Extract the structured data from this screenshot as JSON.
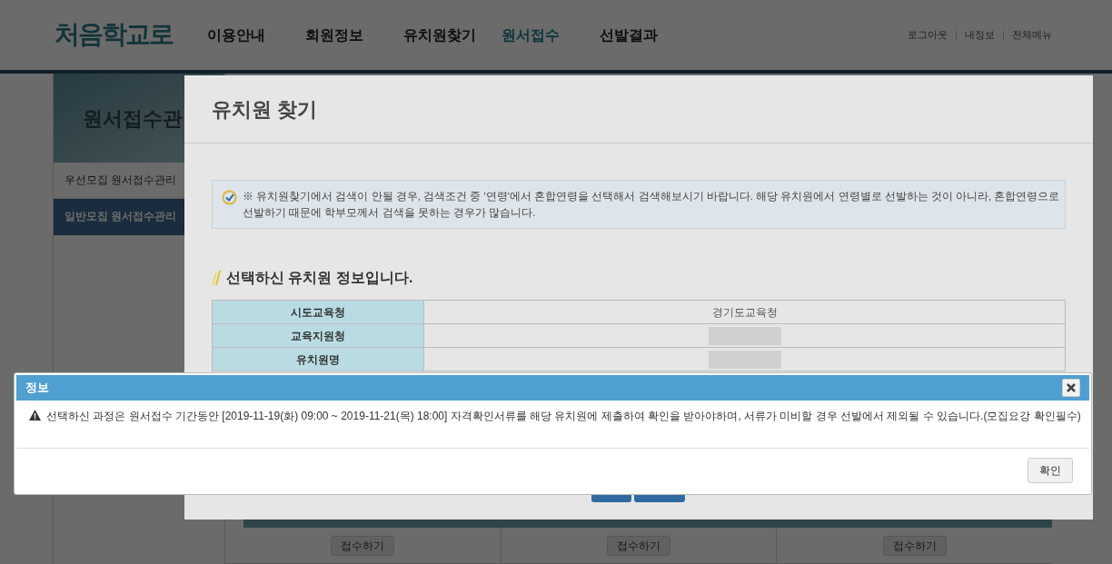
{
  "header": {
    "logo": "처음학교로",
    "nav": [
      {
        "label": "이용안내",
        "selected": false
      },
      {
        "label": "회원정보",
        "selected": false
      },
      {
        "label": "유치원찾기",
        "selected": false
      },
      {
        "label": "원서접수",
        "selected": true
      },
      {
        "label": "선발결과",
        "selected": false
      }
    ],
    "util_links": [
      "로그아웃",
      "내정보",
      "전체메뉴"
    ]
  },
  "sidebar": {
    "title": "원서접수관",
    "items": [
      {
        "label": "우선모집 원서접수관리",
        "selected": false
      },
      {
        "label": "일반모집 원서접수관리",
        "selected": true
      }
    ]
  },
  "background_table": {
    "row_buttons": [
      "접수하기",
      "접수하기",
      "접수하기"
    ]
  },
  "modal": {
    "title": "유치원 찾기",
    "notice": "※ 유치원찾기에서 검색이 안될 경우, 검색조건 중 '연령'에서 혼합연령을 선택해서 검색해보시기 바랍니다. 해당 유치원에서 연령별로 선발하는 것이 아니라, 혼합연령으로 선발하기 때문에 학부모께서 검색을 못하는 경우가 많습니다.",
    "section_title": "선택하신 유치원 정보입니다.",
    "info_rows": [
      {
        "label": "시도교육청",
        "value": "경기도교육청",
        "redacted": false
      },
      {
        "label": "교육지원청",
        "redacted": true
      },
      {
        "label": "유치원명",
        "redacted": true
      }
    ]
  },
  "dialog": {
    "title": "정보",
    "message": "선택하신 과정은 원서접수 기간동안 [2019-11-19(화) 09:00 ~ 2019-11-21(목) 18:00] 자격확인서류를 해당 유치원에 제출하여 확인을 받아야하며, 서류가 미비할 경우 선발에서 제외될 수 있습니다.(모집요강 확인필수)",
    "ok_button": "확인"
  }
}
